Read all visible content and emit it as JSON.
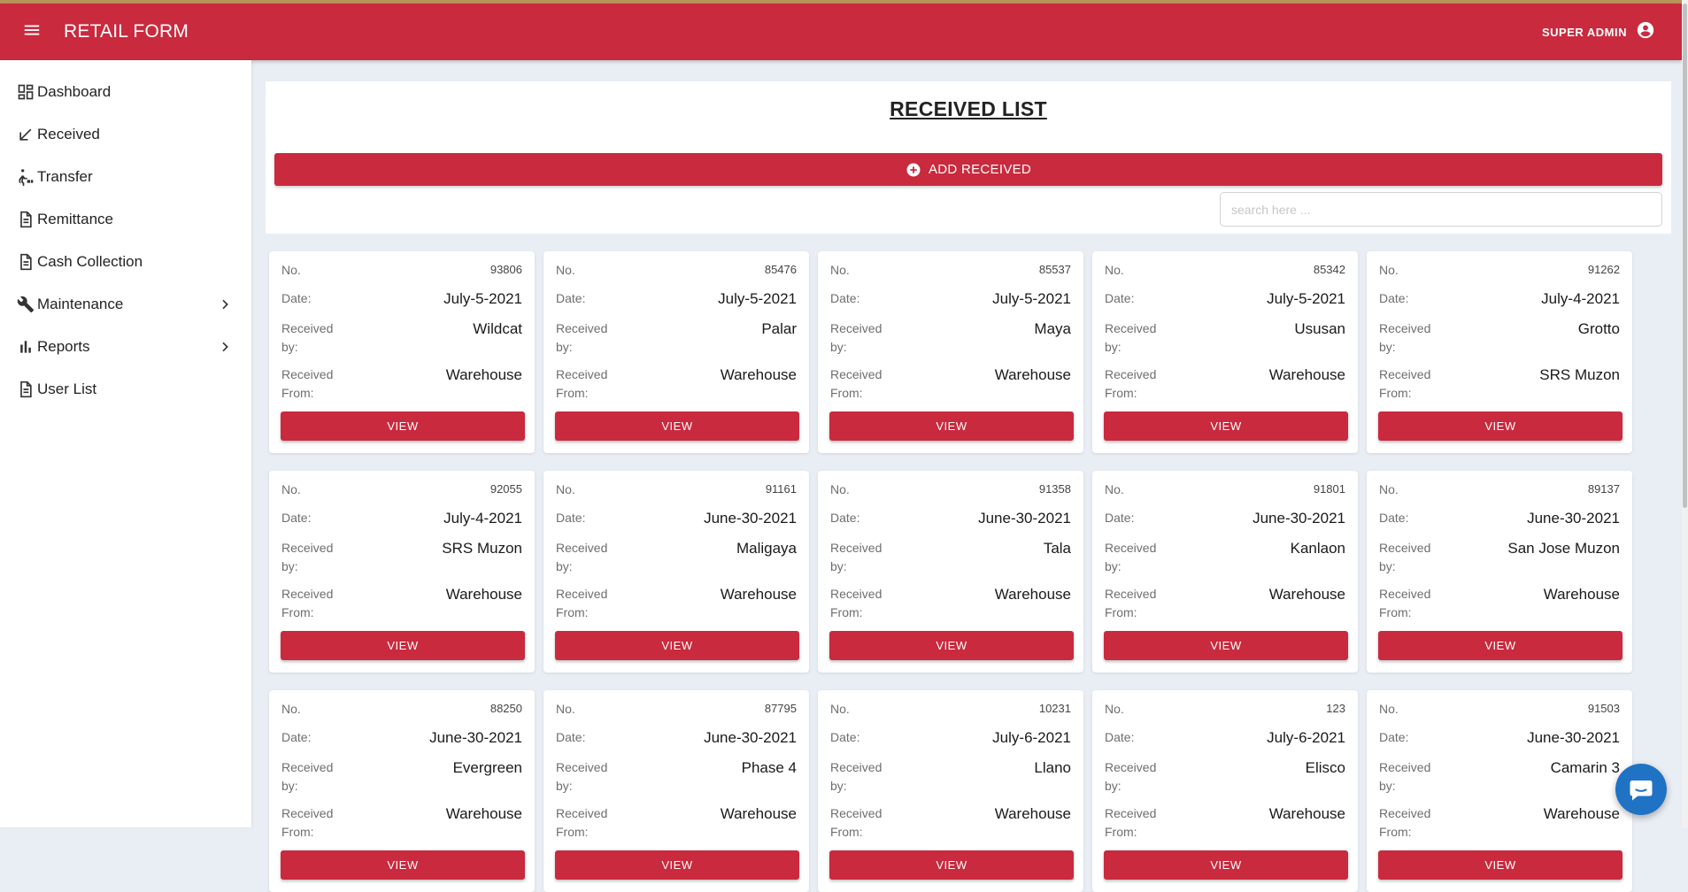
{
  "app": {
    "title": "RETAIL FORM",
    "user_label": "SUPER ADMIN"
  },
  "colors": {
    "primary": "#c92a3e",
    "chat": "#1f72c4"
  },
  "sidebar": {
    "items": [
      {
        "label": "Dashboard",
        "icon": "dashboard-icon"
      },
      {
        "label": "Received",
        "icon": "arrow-down-left-icon"
      },
      {
        "label": "Transfer",
        "icon": "transfer-icon"
      },
      {
        "label": "Remittance",
        "icon": "document-icon"
      },
      {
        "label": "Cash Collection",
        "icon": "document-icon"
      },
      {
        "label": "Maintenance",
        "icon": "wrench-icon",
        "expandable": true
      },
      {
        "label": "Reports",
        "icon": "bar-chart-icon",
        "expandable": true
      },
      {
        "label": "User List",
        "icon": "document-icon"
      }
    ]
  },
  "main": {
    "title": "RECEIVED LIST",
    "add_button_label": "ADD RECEIVED",
    "search_placeholder": "search here ...",
    "labels": {
      "no": "No.",
      "date": "Date:",
      "received_by_1": "Received",
      "received_by_2": "by:",
      "received_from_1": "Received",
      "received_from_2": "From:",
      "view": "VIEW"
    },
    "cards": [
      {
        "no": "93806",
        "date": "July-5-2021",
        "received_by": "Wildcat",
        "received_from": "Warehouse"
      },
      {
        "no": "85476",
        "date": "July-5-2021",
        "received_by": "Palar",
        "received_from": "Warehouse"
      },
      {
        "no": "85537",
        "date": "July-5-2021",
        "received_by": "Maya",
        "received_from": "Warehouse"
      },
      {
        "no": "85342",
        "date": "July-5-2021",
        "received_by": "Ususan",
        "received_from": "Warehouse"
      },
      {
        "no": "91262",
        "date": "July-4-2021",
        "received_by": "Grotto",
        "received_from": "SRS Muzon"
      },
      {
        "no": "92055",
        "date": "July-4-2021",
        "received_by": "SRS Muzon",
        "received_from": "Warehouse"
      },
      {
        "no": "91161",
        "date": "June-30-2021",
        "received_by": "Maligaya",
        "received_from": "Warehouse"
      },
      {
        "no": "91358",
        "date": "June-30-2021",
        "received_by": "Tala",
        "received_from": "Warehouse"
      },
      {
        "no": "91801",
        "date": "June-30-2021",
        "received_by": "Kanlaon",
        "received_from": "Warehouse"
      },
      {
        "no": "89137",
        "date": "June-30-2021",
        "received_by": "San Jose Muzon",
        "received_from": "Warehouse"
      },
      {
        "no": "88250",
        "date": "June-30-2021",
        "received_by": "Evergreen",
        "received_from": "Warehouse"
      },
      {
        "no": "87795",
        "date": "June-30-2021",
        "received_by": "Phase 4",
        "received_from": "Warehouse"
      },
      {
        "no": "10231",
        "date": "July-6-2021",
        "received_by": "Llano",
        "received_from": "Warehouse"
      },
      {
        "no": "123",
        "date": "July-6-2021",
        "received_by": "Elisco",
        "received_from": "Warehouse"
      },
      {
        "no": "91503",
        "date": "June-30-2021",
        "received_by": "Camarin 3",
        "received_from": "Warehouse"
      }
    ]
  }
}
